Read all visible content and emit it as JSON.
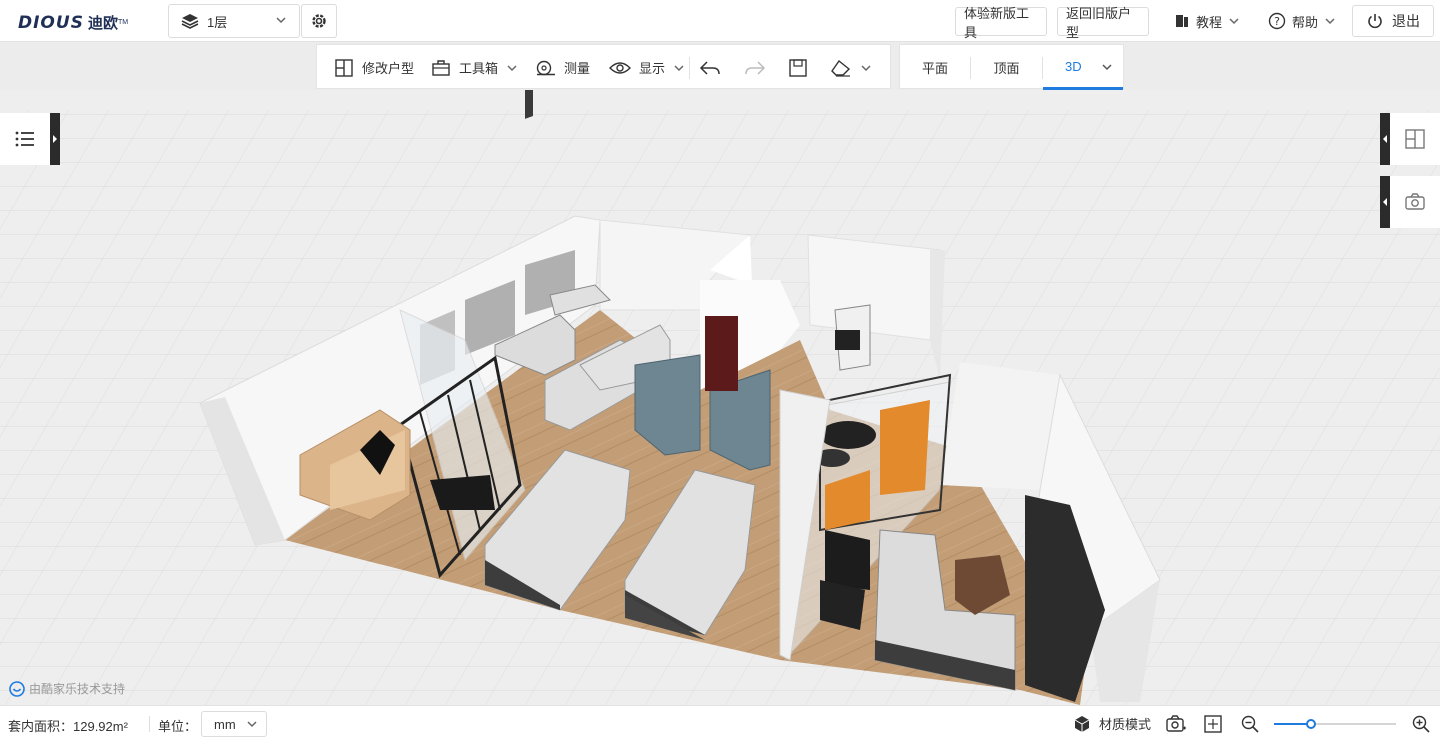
{
  "app": {
    "logo_text": "DIOUS",
    "logo_cn": "迪欧",
    "logo_tm": "TM"
  },
  "header": {
    "floor_label": "1层",
    "try_new_tool": "体验新版工具",
    "back_old": "返回旧版户型",
    "tutorial": "教程",
    "help": "帮助",
    "exit": "退出"
  },
  "toolbar": {
    "modify_layout": "修改户型",
    "toolbox": "工具箱",
    "measure": "测量",
    "display": "显示"
  },
  "views": {
    "tabs": [
      "平面",
      "顶面",
      "3D"
    ],
    "active": "3D"
  },
  "credit": "由酷家乐技术支持",
  "status": {
    "area_label": "套内面积：129.92m²",
    "unit_label": "单位：",
    "unit_value": "mm",
    "material_mode": "材质模式",
    "zoom_fraction": 0.3
  },
  "colors": {
    "accent": "#1f7be0",
    "floor_wood": "#bf9a72",
    "wall": "#f4f4f4"
  }
}
